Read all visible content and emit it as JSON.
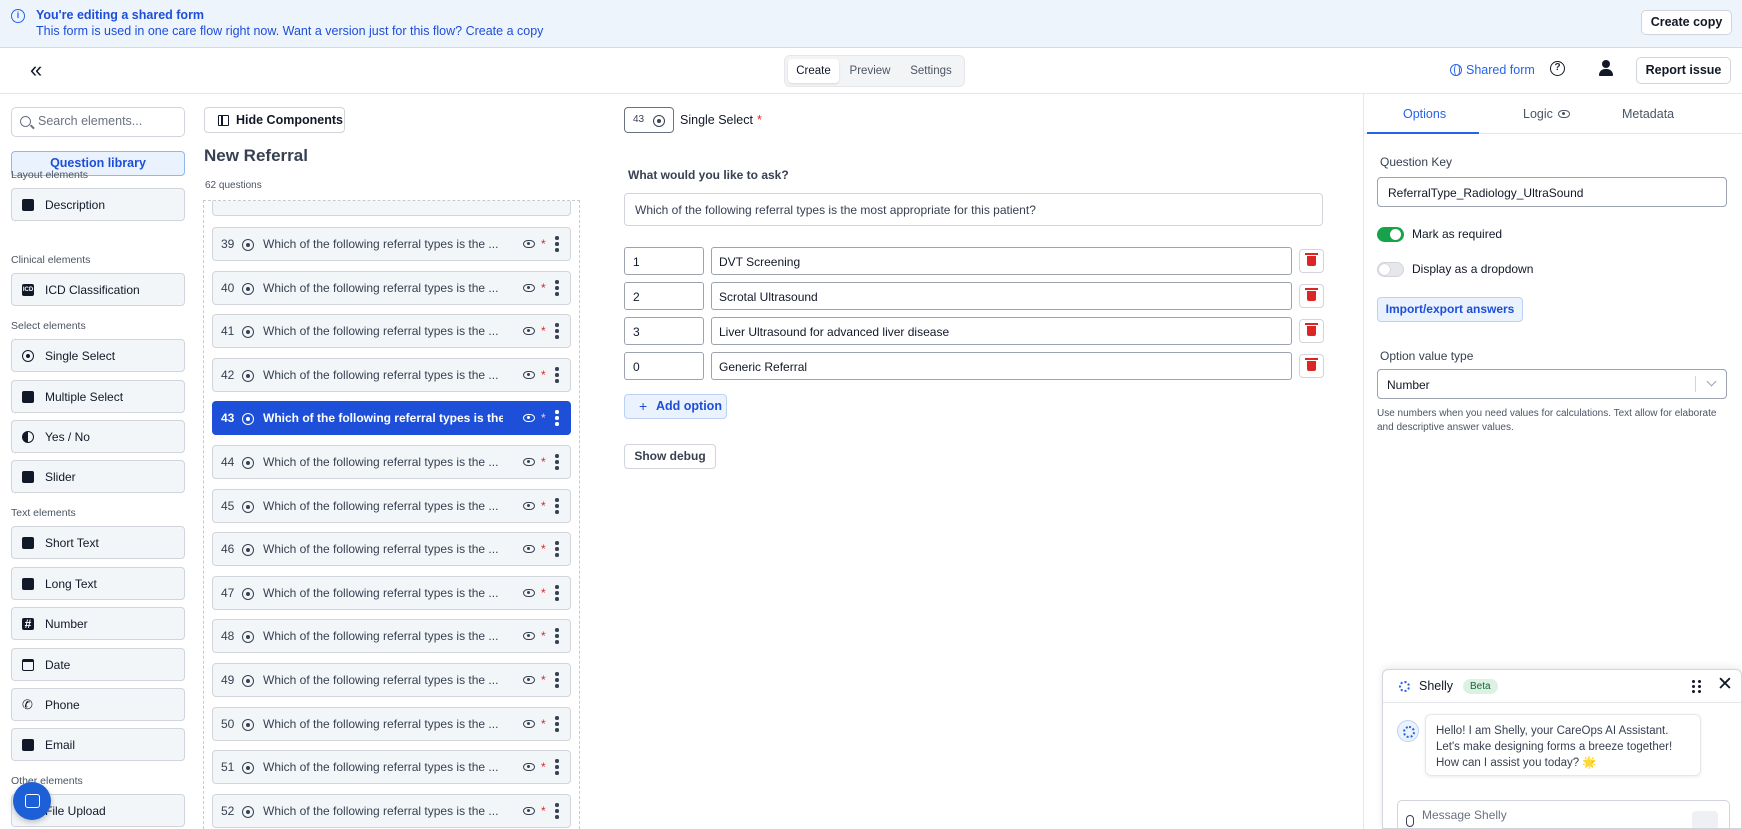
{
  "banner": {
    "title": "You're editing a shared form",
    "subtitle": "This form is used in one care flow right now. Want a version just for this flow? Create a copy",
    "button": "Create copy"
  },
  "header": {
    "tabs": [
      {
        "label": "Create",
        "active": true
      },
      {
        "label": "Preview",
        "active": false
      },
      {
        "label": "Settings",
        "active": false
      }
    ],
    "shared_form": "Shared form",
    "report_issue": "Report issue"
  },
  "library": {
    "search_placeholder": "Search elements...",
    "question_library": "Question library",
    "categories": [
      {
        "name": "Layout elements",
        "items": [
          {
            "label": "Description",
            "icon": "description-icon"
          }
        ]
      },
      {
        "name": "Clinical elements",
        "items": [
          {
            "label": "ICD Classification",
            "icon": "icd-icon"
          }
        ]
      },
      {
        "name": "Select elements",
        "items": [
          {
            "label": "Single Select",
            "icon": "radio-icon"
          },
          {
            "label": "Multiple Select",
            "icon": "checkbox-icon"
          },
          {
            "label": "Yes / No",
            "icon": "yes-no-icon"
          },
          {
            "label": "Slider",
            "icon": "slider-icon"
          }
        ]
      },
      {
        "name": "Text elements",
        "items": [
          {
            "label": "Short Text",
            "icon": "short-text-icon"
          },
          {
            "label": "Long Text",
            "icon": "long-text-icon"
          },
          {
            "label": "Number",
            "icon": "hash-icon"
          },
          {
            "label": "Date",
            "icon": "calendar-icon"
          },
          {
            "label": "Phone",
            "icon": "phone-icon"
          },
          {
            "label": "Email",
            "icon": "email-icon"
          }
        ]
      },
      {
        "name": "Other elements",
        "items": [
          {
            "label": "File Upload",
            "icon": "file-upload-icon"
          }
        ]
      }
    ]
  },
  "list": {
    "hide_components": "Hide Components",
    "form_title": "New Referral",
    "question_count": "62 questions",
    "question_text": "Which of the following referral types is the ...",
    "questions": [
      {
        "num": "39",
        "active": false
      },
      {
        "num": "40",
        "active": false
      },
      {
        "num": "41",
        "active": false
      },
      {
        "num": "42",
        "active": false
      },
      {
        "num": "43",
        "active": true
      },
      {
        "num": "44",
        "active": false
      },
      {
        "num": "45",
        "active": false
      },
      {
        "num": "46",
        "active": false
      },
      {
        "num": "47",
        "active": false
      },
      {
        "num": "48",
        "active": false
      },
      {
        "num": "49",
        "active": false
      },
      {
        "num": "50",
        "active": false
      },
      {
        "num": "51",
        "active": false
      },
      {
        "num": "52",
        "active": false
      }
    ],
    "required_mark": "*"
  },
  "editor": {
    "question_number": "43",
    "question_type": "Single Select",
    "required_mark": "*",
    "ask_label": "What would you like to ask?",
    "question": "Which of the following referral types is the most appropriate for this patient?",
    "options": [
      {
        "value": "1",
        "label": "DVT Screening"
      },
      {
        "value": "2",
        "label": "Scrotal Ultrasound"
      },
      {
        "value": "3",
        "label": "Liver Ultrasound for advanced liver disease"
      },
      {
        "value": "0",
        "label": "Generic Referral"
      }
    ],
    "add_option": "Add option",
    "show_debug": "Show debug"
  },
  "panel": {
    "tabs": [
      "Options",
      "Logic",
      "Metadata"
    ],
    "question_key_label": "Question Key",
    "question_key": "ReferralType_Radiology_UltraSound",
    "mark_required": "Mark as required",
    "mark_required_on": true,
    "dropdown": "Display as a dropdown",
    "dropdown_on": false,
    "import_export": "Import/export answers",
    "option_value_type_label": "Option value type",
    "option_value_type": "Number",
    "help": "Use numbers when you need values for calculations. Text allow for elaborate and descriptive answer values."
  },
  "chat": {
    "name": "Shelly",
    "beta": "Beta",
    "message": "Hello! I am Shelly, your CareOps AI Assistant. Let's make designing forms a breeze together! How can I assist you today? 🌟",
    "placeholder": "Message Shelly"
  },
  "colors": {
    "accent": "#1d4fd8",
    "banner_bg": "#eef4fc",
    "toggle_on": "#16a34a",
    "danger": "#dc2626"
  }
}
